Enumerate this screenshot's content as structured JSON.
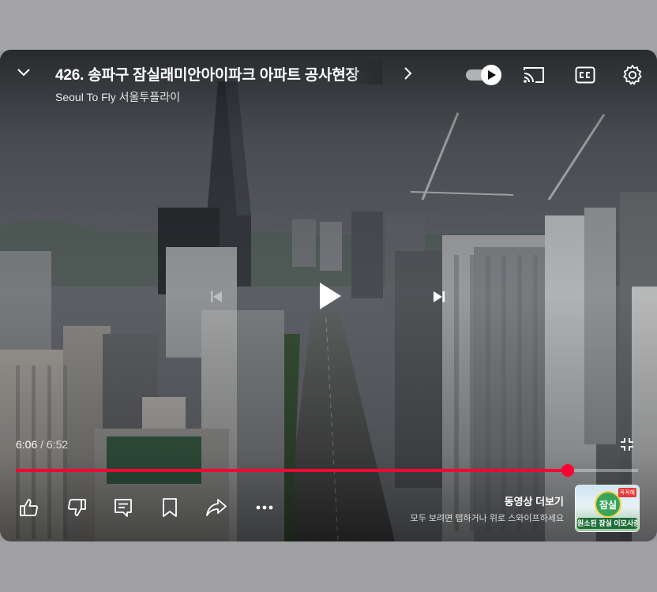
{
  "video": {
    "title": "426. 송파구 잠실래미안아이파크 아파트 공사현장",
    "channel": "Seoul To Fly 서울투플라이"
  },
  "time": {
    "current": "6:06",
    "separator": "/",
    "duration": "6:52"
  },
  "progress": {
    "played_fraction": 0.887
  },
  "autoplay": {
    "enabled": true
  },
  "icons": {
    "collapse": "chevron-down-icon",
    "title_more": "chevron-right-icon",
    "autoplay": "autoplay-toggle-icon",
    "cast": "cast-icon",
    "captions": "cc-icon",
    "settings": "gear-icon",
    "previous": "skip-previous-icon",
    "play": "play-icon",
    "next": "skip-next-icon",
    "fullscreen": "exit-fullscreen-icon",
    "like": "thumbs-up-icon",
    "dislike": "thumbs-down-icon",
    "comments": "comment-icon",
    "save": "bookmark-icon",
    "share": "share-icon",
    "more": "more-horizontal-icon"
  },
  "more_videos": {
    "heading": "동영상 더보기",
    "hint": "모두 보려면 탭하거나 위로 스와이프하세요",
    "thumbnail_caption": "원소된 잠실 이모사준",
    "thumbnail_badge": "꼭꼭해",
    "thumbnail_logo": "잠실"
  },
  "colors": {
    "accent": "#ff0033",
    "page_background": "#9a9a9e",
    "text": "#ffffff"
  }
}
